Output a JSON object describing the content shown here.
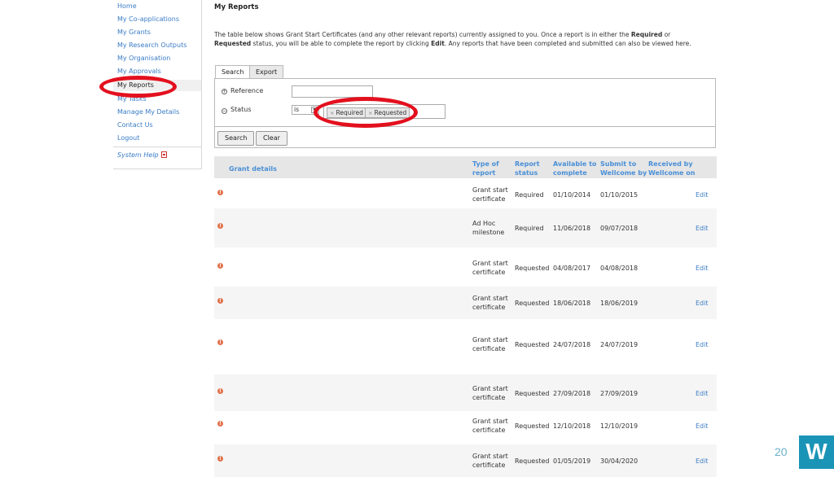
{
  "sidebar": {
    "items": [
      {
        "label": "Home"
      },
      {
        "label": "My Co-applications"
      },
      {
        "label": "My Grants"
      },
      {
        "label": "My Research Outputs"
      },
      {
        "label": "My Organisation"
      },
      {
        "label": "My Approvals"
      },
      {
        "label": "My Reports"
      },
      {
        "label": "My Tasks"
      },
      {
        "label": "Manage My Details"
      },
      {
        "label": "Contact Us"
      },
      {
        "label": "Logout"
      }
    ],
    "help": "System Help"
  },
  "page": {
    "title": "My Reports",
    "intro_1": "The table below shows Grant Start Certificates (and any other relevant reports) currently assigned to you. Once a report is in either the ",
    "intro_required": "Required",
    "intro_2": " or ",
    "intro_requested": "Requested",
    "intro_3": " status, you will be able to complete the report by clicking ",
    "intro_edit": "Edit",
    "intro_4": ". Any reports that have been completed and submitted can also be viewed here."
  },
  "tabs": [
    {
      "label": "Search"
    },
    {
      "label": "Export"
    }
  ],
  "search": {
    "reference_label": "Reference",
    "reference_value": "",
    "status_label": "Status",
    "operator": "is",
    "tags": [
      "Required",
      "Requested"
    ],
    "search_button": "Search",
    "clear_button": "Clear"
  },
  "table": {
    "headers": {
      "grant_details": "Grant details",
      "type": [
        "Type of",
        "report"
      ],
      "status": [
        "Report",
        "status"
      ],
      "available": [
        "Available to",
        "complete"
      ],
      "submit": [
        "Submit to",
        "Wellcome by"
      ],
      "received": [
        "Received by",
        "Wellcome on"
      ]
    },
    "rows": [
      {
        "type": [
          "Grant start",
          "certificate"
        ],
        "status": "Required",
        "available": "01/10/2014",
        "submit": "01/10/2015",
        "action": "Edit"
      },
      {
        "type": [
          "Ad Hoc",
          "milestone"
        ],
        "status": "Required",
        "available": "11/06/2018",
        "submit": "09/07/2018",
        "action": "Edit"
      },
      {
        "type": [
          "Grant start",
          "certificate"
        ],
        "status": "Requested",
        "available": "04/08/2017",
        "submit": "04/08/2018",
        "action": "Edit"
      },
      {
        "type": [
          "Grant start",
          "certificate"
        ],
        "status": "Requested",
        "available": "18/06/2018",
        "submit": "18/06/2019",
        "action": "Edit"
      },
      {
        "type": [
          "Grant start",
          "certificate"
        ],
        "status": "Requested",
        "available": "24/07/2018",
        "submit": "24/07/2019",
        "action": "Edit"
      },
      {
        "type": [
          "Grant start",
          "certificate"
        ],
        "status": "Requested",
        "available": "27/09/2018",
        "submit": "27/09/2019",
        "action": "Edit"
      },
      {
        "type": [
          "Grant start",
          "certificate"
        ],
        "status": "Requested",
        "available": "12/10/2018",
        "submit": "12/10/2019",
        "action": "Edit"
      },
      {
        "type": [
          "Grant start",
          "certificate"
        ],
        "status": "Requested",
        "available": "01/05/2019",
        "submit": "30/04/2020",
        "action": "Edit"
      }
    ]
  },
  "slide": {
    "page_number": "20",
    "logo_letter": "W"
  },
  "colors": {
    "link": "#3a7cc6",
    "highlight_circle": "#e3101e",
    "logo": "#1a94b6"
  }
}
